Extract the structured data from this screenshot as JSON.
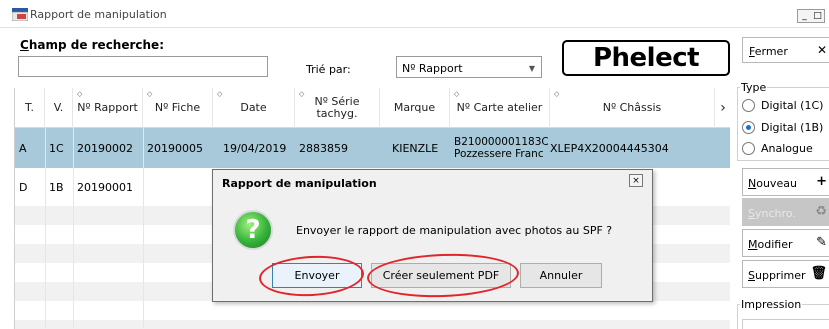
{
  "window": {
    "title": "Rapport de manipulation",
    "minimize": "_",
    "restore": "□",
    "close": "×"
  },
  "search": {
    "label": "Champ de recherche:",
    "value": "",
    "placeholder": ""
  },
  "sort": {
    "label": "Trié par:",
    "selected": "Nº Rapport"
  },
  "logo": {
    "text": "Phelect"
  },
  "table": {
    "columns": [
      "T.",
      "V.",
      "Nº Rapport",
      "Nº Fiche",
      "Date",
      "Nº Série tachyg.",
      "Marque",
      "Nº Carte atelier",
      "Nº Châssis"
    ],
    "column_lines": [
      [
        "T."
      ],
      [
        "V."
      ],
      [
        "Nº Rapport"
      ],
      [
        "Nº Fiche"
      ],
      [
        "Date"
      ],
      [
        "Nº Série",
        "tachyg."
      ],
      [
        "Marque"
      ],
      [
        "Nº Carte atelier"
      ],
      [
        "Nº Châssis"
      ]
    ],
    "scroll_right": "›",
    "rows": [
      {
        "t": "A",
        "v": "1C",
        "rapport": "20190002",
        "fiche": "20190005",
        "date": "19/04/2019",
        "serie": "2883859",
        "marque": "KIENZLE",
        "carte_line1": "B210000001183C",
        "carte_line2": "Pozzessere Franc",
        "chassis": "XLEP4X20004445304",
        "selected": true
      },
      {
        "t": "D",
        "v": "1B",
        "rapport": "20190001",
        "fiche": "",
        "date": "",
        "serie": "",
        "marque": "",
        "carte_line1": "",
        "carte_line2": "",
        "chassis": "",
        "selected": false
      }
    ]
  },
  "right_panel": {
    "fermer": "Fermer",
    "type_legend": "Type",
    "types": [
      {
        "label": "Digital (1C)",
        "checked": false
      },
      {
        "label": "Digital (1B)",
        "checked": true
      },
      {
        "label": "Analogue",
        "checked": false
      }
    ],
    "nouveau": "Nouveau",
    "synchro": "Synchro.",
    "modifier": "Modifier",
    "supprimer": "Supprimer",
    "impression_legend": "Impression"
  },
  "dialog": {
    "title": "Rapport de manipulation",
    "close": "×",
    "icon": "?",
    "message": "Envoyer le rapport de manipulation avec photos au SPF ?",
    "buttons": {
      "send": "Envoyer",
      "pdf_only": "Créer seulement PDF",
      "cancel": "Annuler"
    }
  },
  "colors": {
    "selected_row": "#a7c9d9",
    "annotation_red": "#e0262a",
    "dialog_bg": "#f0f0f0"
  }
}
